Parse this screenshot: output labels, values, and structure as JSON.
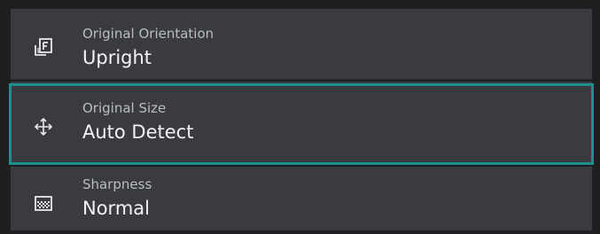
{
  "settings": {
    "items": [
      {
        "label": "Original Orientation",
        "value": "Upright",
        "icon": "orientation-icon"
      },
      {
        "label": "Original Size",
        "value": "Auto Detect",
        "icon": "move-arrows-icon",
        "selected": true
      },
      {
        "label": "Sharpness",
        "value": "Normal",
        "icon": "sharpness-icon"
      }
    ]
  },
  "colors": {
    "background": "#1e1f21",
    "item_background": "#3a3b3e",
    "focus_border": "#1d8f8f",
    "label_text": "#b9bcc0",
    "value_text": "#f2f3f4"
  }
}
